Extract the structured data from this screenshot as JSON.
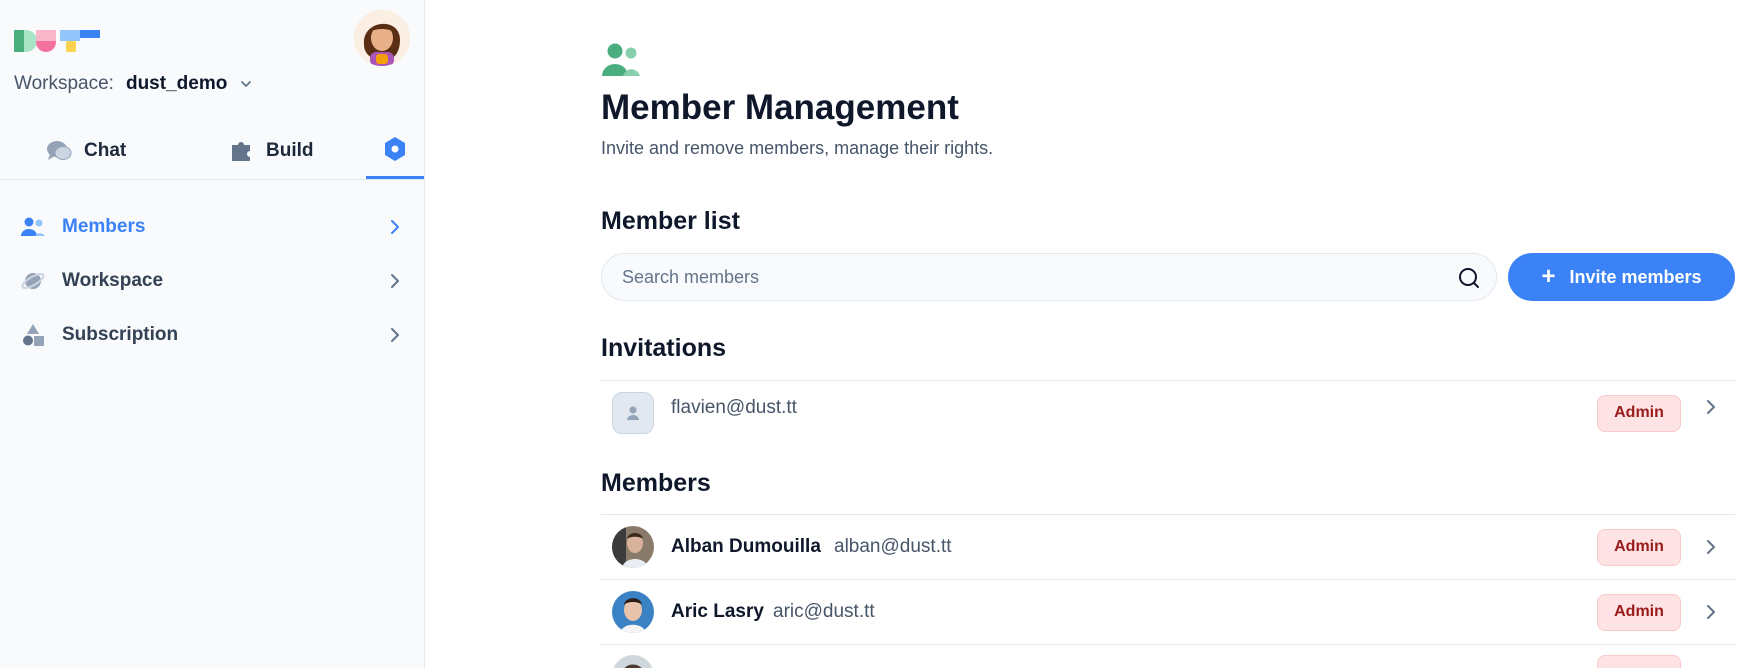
{
  "sidebar": {
    "workspace_label": "Workspace:",
    "workspace_name": "dust_demo",
    "tabs": [
      {
        "label": "Chat",
        "icon": "chat-bubbles-icon"
      },
      {
        "label": "Build",
        "icon": "puzzle-icon"
      },
      {
        "label": "",
        "icon": "admin-hexagon-icon",
        "active": true
      }
    ],
    "nav": [
      {
        "label": "Members",
        "icon": "users-icon",
        "active": true
      },
      {
        "label": "Workspace",
        "icon": "planet-icon",
        "active": false
      },
      {
        "label": "Subscription",
        "icon": "shapes-icon",
        "active": false
      }
    ]
  },
  "main": {
    "title": "Member Management",
    "subtitle": "Invite and remove members, manage their rights.",
    "member_list_heading": "Member list",
    "search": {
      "placeholder": "Search members",
      "value": ""
    },
    "invite_button": "Invite members",
    "invitations_heading": "Invitations",
    "invitations": [
      {
        "email": "flavien@dust.tt",
        "role": "Admin"
      }
    ],
    "members_heading": "Members",
    "members": [
      {
        "name": "Alban Dumouilla",
        "email": "alban@dust.tt",
        "role": "Admin"
      },
      {
        "name": "Aric Lasry",
        "email": "aric@dust.tt",
        "role": "Admin"
      }
    ]
  },
  "colors": {
    "accent": "#3b82f6",
    "badge_bg": "#fde3e3",
    "badge_text": "#991b1b",
    "page_icon": "#4bae7f"
  }
}
